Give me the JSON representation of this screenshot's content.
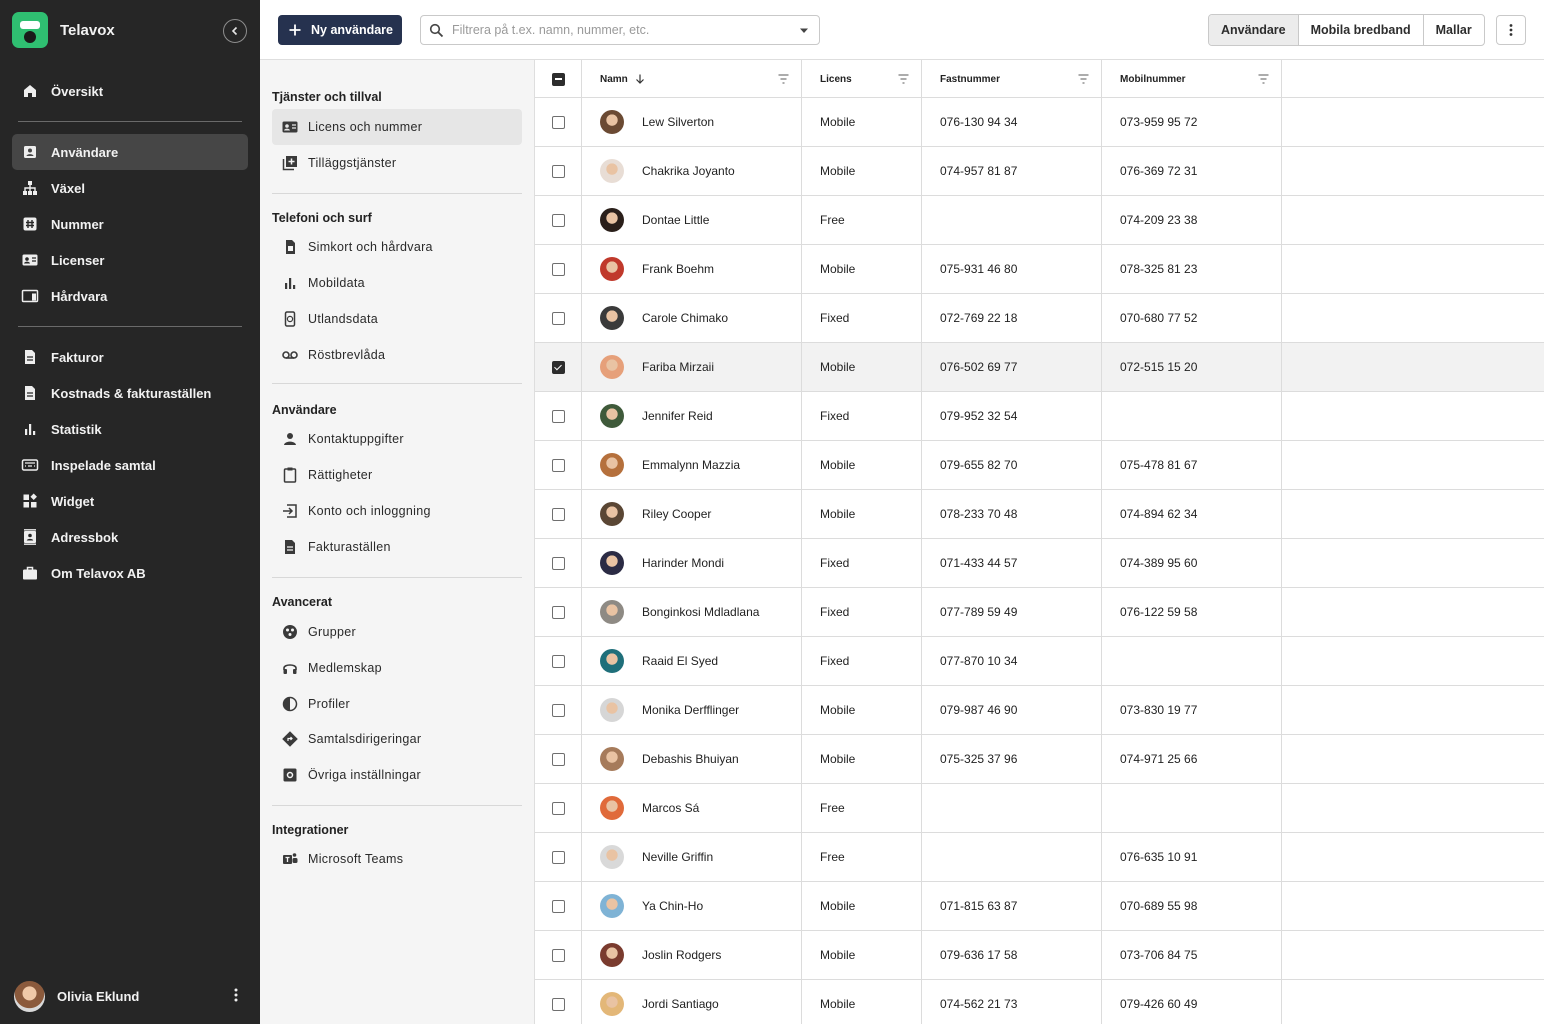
{
  "app": {
    "name": "Telavox"
  },
  "nav": {
    "items": [
      {
        "label": "Översikt",
        "icon": "home-icon"
      },
      {
        "label": "Användare",
        "icon": "user-card-icon",
        "active": true
      },
      {
        "label": "Växel",
        "icon": "org-chart-icon"
      },
      {
        "label": "Nummer",
        "icon": "hash-icon"
      },
      {
        "label": "Licenser",
        "icon": "id-card-icon"
      },
      {
        "label": "Hårdvara",
        "icon": "screen-phone-icon"
      },
      {
        "label": "Fakturor",
        "icon": "document-icon"
      },
      {
        "label": "Kostnads & fakturaställen",
        "icon": "document-icon"
      },
      {
        "label": "Statistik",
        "icon": "bar-chart-icon"
      },
      {
        "label": "Inspelade samtal",
        "icon": "keyboard-icon"
      },
      {
        "label": "Widget",
        "icon": "widget-icon"
      },
      {
        "label": "Adressbok",
        "icon": "contacts-icon"
      },
      {
        "label": "Om Telavox AB",
        "icon": "briefcase-icon"
      }
    ],
    "user": {
      "name": "Olivia Eklund"
    }
  },
  "topbar": {
    "new_user_label": "Ny användare",
    "search_placeholder": "Filtrera på t.ex. namn, nummer, etc.",
    "tabs": [
      "Användare",
      "Mobila bredband",
      "Mallar"
    ],
    "active_tab": "Användare"
  },
  "menu": {
    "sections": [
      {
        "title": "Tjänster och tillval",
        "items": [
          {
            "label": "Licens och nummer",
            "icon": "id-card-icon",
            "active": true
          },
          {
            "label": "Tilläggstjänster",
            "icon": "library-add-icon"
          }
        ]
      },
      {
        "title": "Telefoni och surf",
        "items": [
          {
            "label": "Simkort och hårdvara",
            "icon": "sim-card-icon"
          },
          {
            "label": "Mobildata",
            "icon": "bar-chart-icon"
          },
          {
            "label": "Utlandsdata",
            "icon": "phone-globe-icon"
          },
          {
            "label": "Röstbrevlåda",
            "icon": "voicemail-icon"
          }
        ]
      },
      {
        "title": "Användare",
        "items": [
          {
            "label": "Kontaktuppgifter",
            "icon": "person-icon"
          },
          {
            "label": "Rättigheter",
            "icon": "clipboard-icon"
          },
          {
            "label": "Konto och inloggning",
            "icon": "login-icon"
          },
          {
            "label": "Fakturaställen",
            "icon": "document-icon"
          }
        ]
      },
      {
        "title": "Avancerat",
        "items": [
          {
            "label": "Grupper",
            "icon": "group-icon"
          },
          {
            "label": "Medlemskap",
            "icon": "headset-icon"
          },
          {
            "label": "Profiler",
            "icon": "contrast-icon"
          },
          {
            "label": "Samtalsdirigeringar",
            "icon": "direction-icon"
          },
          {
            "label": "Övriga inställningar",
            "icon": "settings-box-icon"
          }
        ]
      },
      {
        "title": "Integrationer",
        "items": [
          {
            "label": "Microsoft Teams",
            "icon": "teams-icon"
          }
        ]
      }
    ]
  },
  "table": {
    "columns": [
      "Namn",
      "Licens",
      "Fastnummer",
      "Mobilnummer"
    ],
    "sort": {
      "column": "Namn",
      "direction": "desc"
    },
    "rows": [
      {
        "name": "Lew Silverton",
        "license": "Mobile",
        "fixed": "076-130 94 34",
        "mobile": "073-959 95 72",
        "avatar": "#6b4a33"
      },
      {
        "name": "Chakrika Joyanto",
        "license": "Mobile",
        "fixed": "074-957 81 87",
        "mobile": "076-369 72 31",
        "avatar": "#e8ddd5"
      },
      {
        "name": "Dontae Little",
        "license": "Free",
        "fixed": "",
        "mobile": "074-209 23 38",
        "avatar": "#2a1f1a"
      },
      {
        "name": "Frank Boehm",
        "license": "Mobile",
        "fixed": "075-931 46 80",
        "mobile": "078-325 81 23",
        "avatar": "#c0392b"
      },
      {
        "name": "Carole Chimako",
        "license": "Fixed",
        "fixed": "072-769 22 18",
        "mobile": "070-680 77 52",
        "avatar": "#3a3a3a"
      },
      {
        "name": "Fariba Mirzaii",
        "license": "Mobile",
        "fixed": "076-502 69 77",
        "mobile": "072-515 15 20",
        "avatar": "#e6a07a",
        "selected": true
      },
      {
        "name": "Jennifer Reid",
        "license": "Fixed",
        "fixed": "079-952 32 54",
        "mobile": "",
        "avatar": "#3f5a3a"
      },
      {
        "name": "Emmalynn Mazzia",
        "license": "Mobile",
        "fixed": "079-655 82 70",
        "mobile": "075-478 81 67",
        "avatar": "#b5703c"
      },
      {
        "name": "Riley Cooper",
        "license": "Mobile",
        "fixed": "078-233 70 48",
        "mobile": "074-894 62 34",
        "avatar": "#5a4634"
      },
      {
        "name": "Harinder Mondi",
        "license": "Fixed",
        "fixed": "071-433 44 57",
        "mobile": "074-389 95 60",
        "avatar": "#2b2b44"
      },
      {
        "name": "Bonginkosi Mdladlana",
        "license": "Fixed",
        "fixed": "077-789 59 49",
        "mobile": "076-122 59 58",
        "avatar": "#8e8a84"
      },
      {
        "name": "Raaid El Syed",
        "license": "Fixed",
        "fixed": "077-870 10 34",
        "mobile": "",
        "avatar": "#1f6f7a"
      },
      {
        "name": "Monika Derfflinger",
        "license": "Mobile",
        "fixed": "079-987 46 90",
        "mobile": "073-830 19 77",
        "avatar": "#d6d6d6"
      },
      {
        "name": "Debashis Bhuiyan",
        "license": "Mobile",
        "fixed": "075-325 37 96",
        "mobile": "074-971 25 66",
        "avatar": "#a67b5b"
      },
      {
        "name": "Marcos Sá",
        "license": "Free",
        "fixed": "",
        "mobile": "",
        "avatar": "#e06a3a"
      },
      {
        "name": "Neville Griffin",
        "license": "Free",
        "fixed": "",
        "mobile": "076-635 10 91",
        "avatar": "#d9d9d9"
      },
      {
        "name": "Ya Chin-Ho",
        "license": "Mobile",
        "fixed": "071-815 63 87",
        "mobile": "070-689 55 98",
        "avatar": "#7fb3d5"
      },
      {
        "name": "Joslin Rodgers",
        "license": "Mobile",
        "fixed": "079-636 17 58",
        "mobile": "073-706 84 75",
        "avatar": "#7a3b2e"
      },
      {
        "name": "Jordi Santiago",
        "license": "Mobile",
        "fixed": "074-562 21 73",
        "mobile": "079-426 60 49",
        "avatar": "#e3b778"
      }
    ]
  },
  "colors": {
    "nav_bg": "#262626",
    "primary": "#26324f",
    "brand": "#2fbf71"
  }
}
